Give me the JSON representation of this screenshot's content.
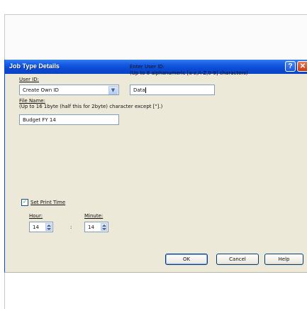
{
  "dialog": {
    "title": "Job Type Details",
    "help_glyph": "?",
    "close_glyph": "✕"
  },
  "user_id": {
    "label": "User ID:",
    "value": "Create Own ID"
  },
  "enter_user_id": {
    "label": "Enter User ID:",
    "hint": "(Up to 8 alphanumeric [a-z,A-Z,0-9] characters)",
    "value": "Data"
  },
  "file_name": {
    "label": "File Name:",
    "hint": "(Up to 16 1byte (half this for 2byte) character except [\"].)",
    "value": "Budget FY 14"
  },
  "print_time": {
    "checkbox_label": "Set Print Time",
    "checked": true,
    "hour_label": "Hour:",
    "hour_value": "14",
    "separator": ":",
    "minute_label": "Minute:",
    "minute_value": "14"
  },
  "buttons": {
    "ok": "OK",
    "cancel": "Cancel",
    "help": "Help"
  },
  "icons": {
    "dropdown": "chevron-down-icon",
    "check": "checkmark-icon"
  }
}
